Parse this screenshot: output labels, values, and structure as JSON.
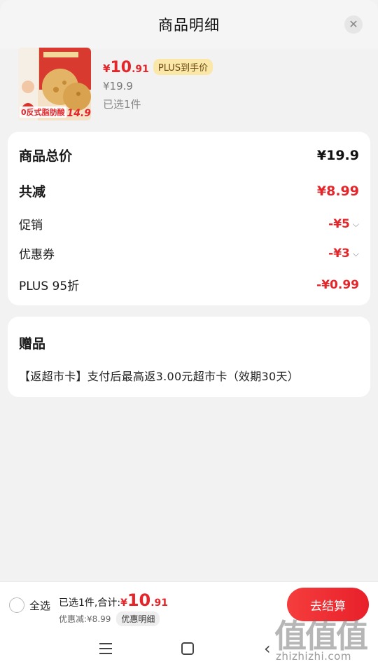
{
  "header": {
    "title": "商品明细",
    "close_icon": "close-icon"
  },
  "product": {
    "image_badge": "0反式脂肪酸",
    "image_price": "14.9",
    "price_symbol": "¥",
    "price_int": "10",
    "price_dec": ".91",
    "plus_tag": "PLUS到手价",
    "original_price": "¥19.9",
    "selected": "已选1件"
  },
  "summary": {
    "total_label": "商品总价",
    "total_value": "¥19.9",
    "reduce_label": "共减",
    "reduce_value": "¥8.99",
    "promo_label": "促销",
    "promo_value": "-¥5",
    "coupon_label": "优惠券",
    "coupon_value": "-¥3",
    "plus_label": "PLUS 95折",
    "plus_value": "-¥0.99"
  },
  "gift": {
    "title": "赠品",
    "text": "【返超市卡】支付后最高返3.00元超市卡（效期30天）"
  },
  "bottom_bar": {
    "select_all": "全选",
    "sum_label": "已选1件,合计:",
    "sum_symbol": "¥",
    "sum_int": "10",
    "sum_dec": ".91",
    "discount_text": "优惠减:¥8.99",
    "detail_chip": "优惠明细",
    "checkout": "去结算"
  },
  "watermark": {
    "big": "值值值",
    "small": "zhizhizhi.com"
  },
  "colors": {
    "accent_red": "#e4262b",
    "plus_gold": "#fbe7a8"
  }
}
